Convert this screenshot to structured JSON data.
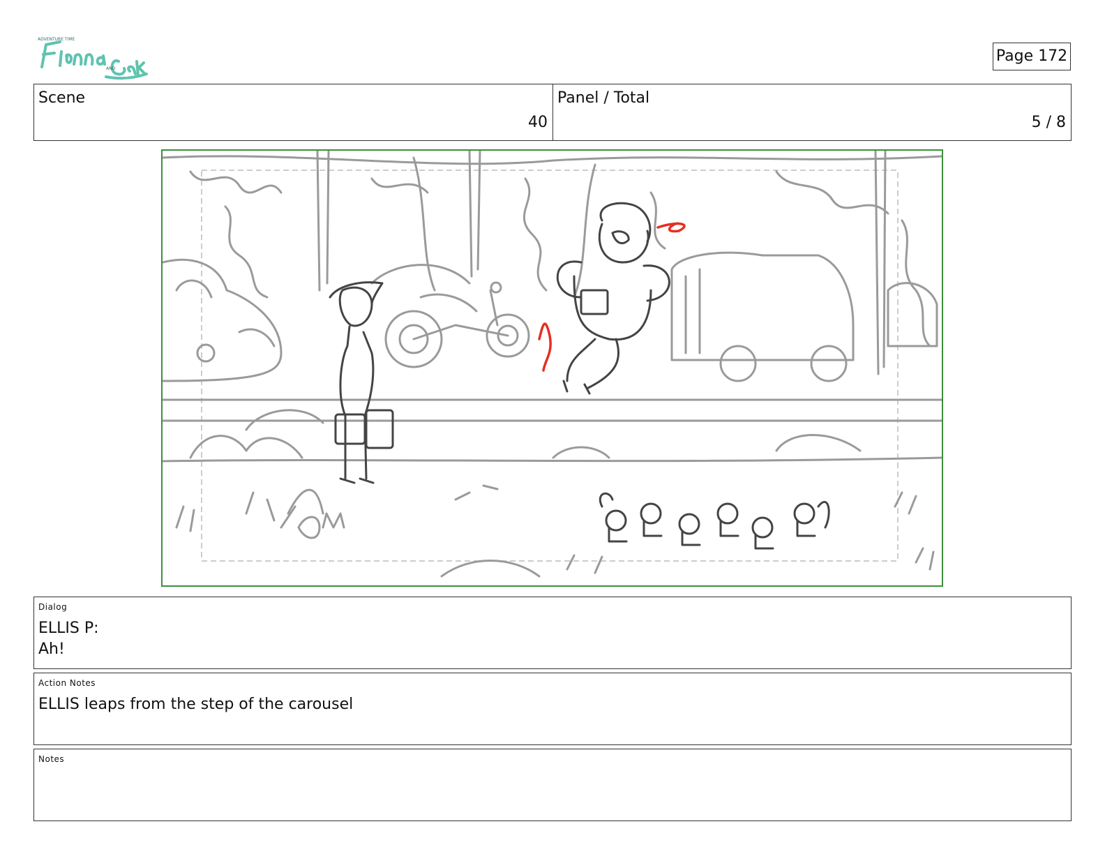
{
  "header": {
    "logo_text": "Fionna and Cake",
    "page_label": "Page 172"
  },
  "scene": {
    "label": "Scene",
    "value": "40"
  },
  "panel": {
    "label": "Panel / Total",
    "value": "5 / 8"
  },
  "dialog": {
    "label": "Dialog",
    "lines": [
      "ELLIS P:",
      "Ah!"
    ]
  },
  "action_notes": {
    "label": "Action Notes",
    "text": "ELLIS leaps from the step of the carousel"
  },
  "notes": {
    "label": "Notes",
    "text": ""
  },
  "colors": {
    "frame_border": "#3b8f3b",
    "sketch_line": "#9a9a9a",
    "figure_line": "#444444",
    "accent_red": "#e53020",
    "logo_teal": "#5fc3b0"
  }
}
